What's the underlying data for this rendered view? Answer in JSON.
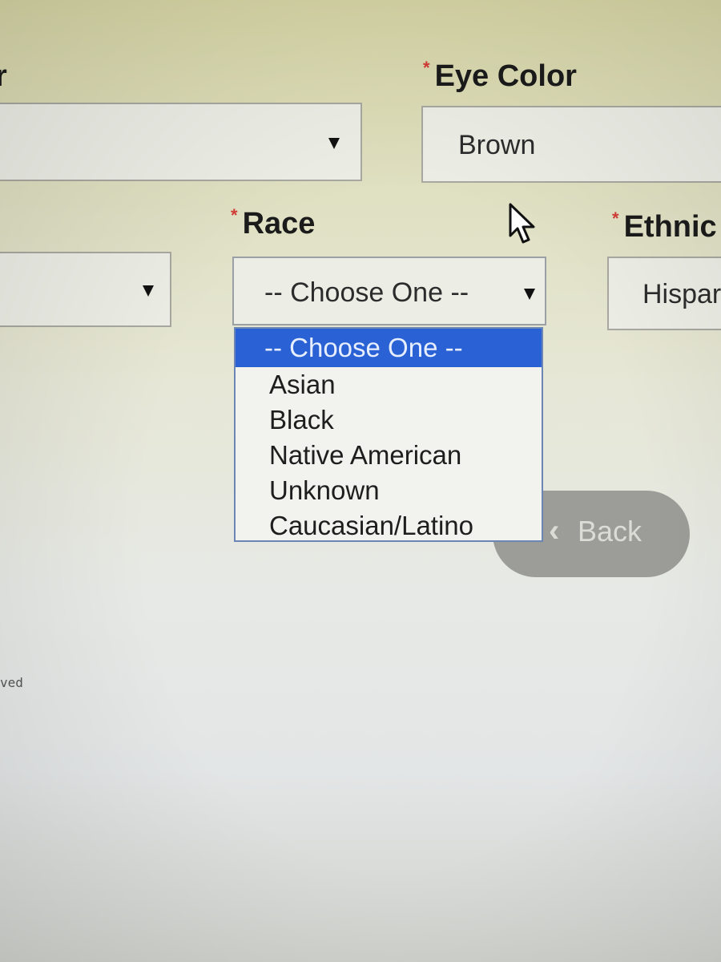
{
  "fields": {
    "left_label_fragment": "r",
    "eye_color": {
      "label": "Eye Color",
      "value": "Brown"
    },
    "race": {
      "label": "Race",
      "value": "-- Choose One --",
      "options": [
        "-- Choose One --",
        "Asian",
        "Black",
        "Native American",
        "Unknown",
        "Caucasian/Latino"
      ],
      "selected_index": 0
    },
    "ethnicity": {
      "label": "Ethnic",
      "value": "Hispar"
    }
  },
  "required_marker": "*",
  "back_button": {
    "label": "Back"
  },
  "footer_fragment": "ved",
  "colors": {
    "required": "#d23b34",
    "selected_option_bg": "#2a62d6",
    "back_button_bg": "#9c9d98"
  },
  "icons": [
    "chevron-down-icon",
    "chevron-left-icon",
    "mouse-pointer-icon"
  ]
}
